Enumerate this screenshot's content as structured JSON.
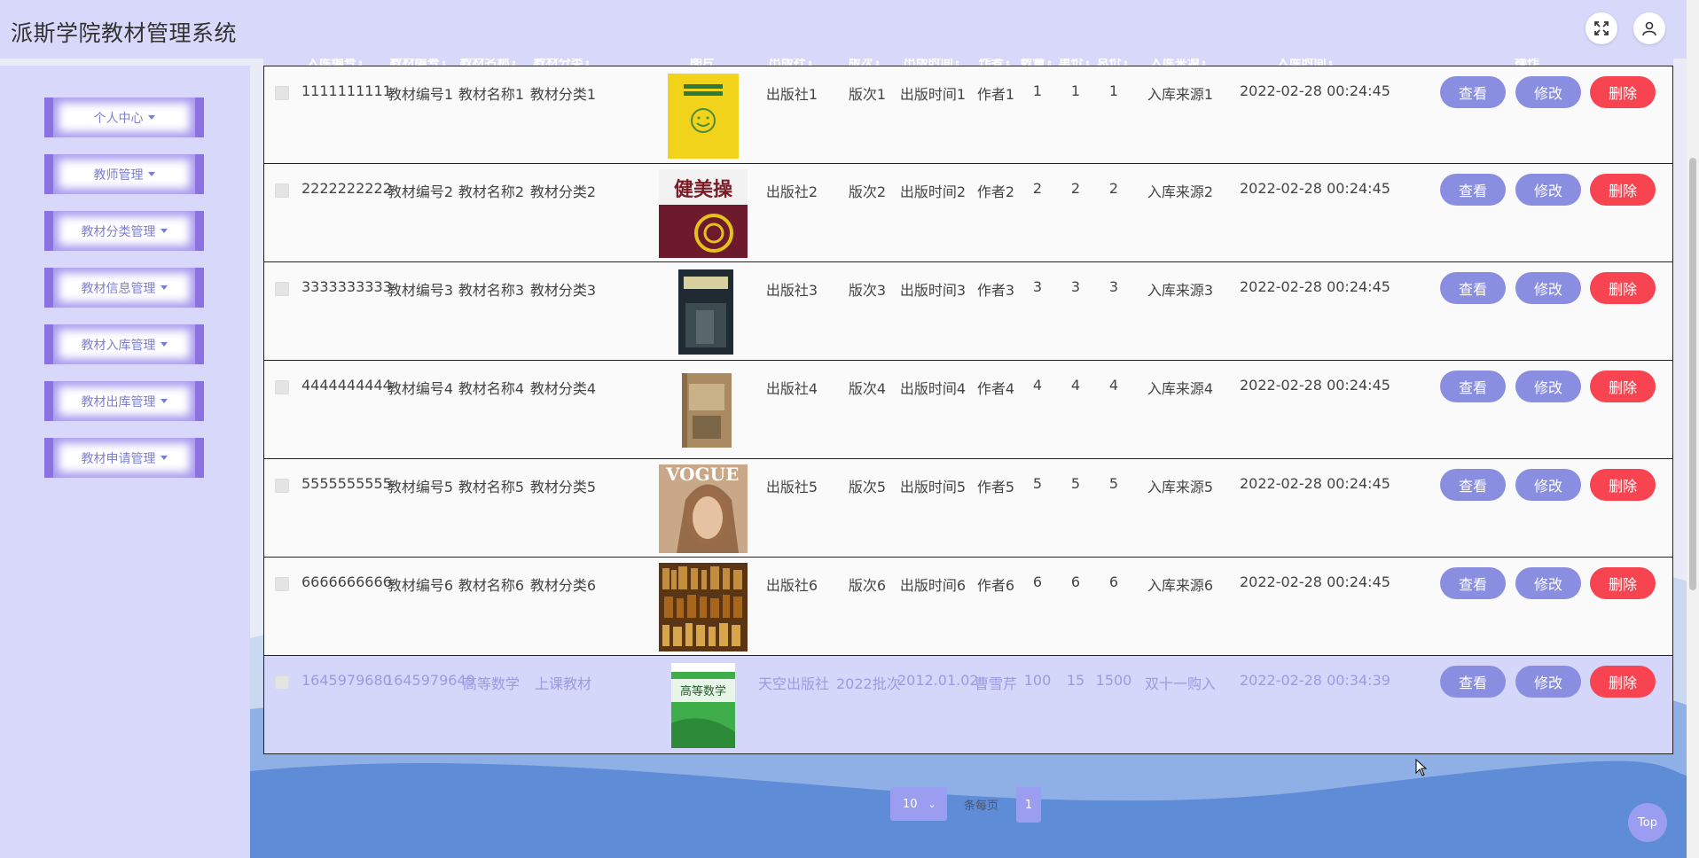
{
  "app": {
    "title": "派斯学院教材管理系统"
  },
  "top_buttons": {
    "fullscreen_icon": "fullscreen-icon",
    "user_icon": "user-icon"
  },
  "sidebar": {
    "items": [
      {
        "label": "个人中心"
      },
      {
        "label": "教师管理"
      },
      {
        "label": "教材分类管理"
      },
      {
        "label": "教材信息管理"
      },
      {
        "label": "教材入库管理"
      },
      {
        "label": "教材出库管理"
      },
      {
        "label": "教材申请管理"
      }
    ]
  },
  "table": {
    "headers": [
      "入库编号",
      "教材编号",
      "教材名称",
      "教材分类",
      "图片",
      "出版社",
      "版次",
      "出版时间",
      "作者",
      "数量",
      "单价",
      "总价",
      "入库来源",
      "入库时间",
      "操作"
    ],
    "buttons": {
      "view": "查看",
      "edit": "修改",
      "delete": "删除"
    },
    "rows": [
      {
        "id": "1111111111",
        "code": "教材编号1",
        "name": "教材名称1",
        "category": "教材分类1",
        "cover": "yellow-book-cover",
        "publisher": "出版社1",
        "edition": "版次1",
        "pub_time": "出版时间1",
        "author": "作者1",
        "qty": "1",
        "price": "1",
        "total": "1",
        "source": "入库来源1",
        "time": "2022-02-28 00:24:45"
      },
      {
        "id": "2222222222",
        "code": "教材编号2",
        "name": "教材名称2",
        "category": "教材分类2",
        "cover": "fitness-book-cover",
        "publisher": "出版社2",
        "edition": "版次2",
        "pub_time": "出版时间2",
        "author": "作者2",
        "qty": "2",
        "price": "2",
        "total": "2",
        "source": "入库来源2",
        "time": "2022-02-28 00:24:45"
      },
      {
        "id": "3333333333",
        "code": "教材编号3",
        "name": "教材名称3",
        "category": "教材分类3",
        "cover": "dark-book-cover",
        "publisher": "出版社3",
        "edition": "版次3",
        "pub_time": "出版时间3",
        "author": "作者3",
        "qty": "3",
        "price": "3",
        "total": "3",
        "source": "入库来源3",
        "time": "2022-02-28 00:24:45"
      },
      {
        "id": "4444444444",
        "code": "教材编号4",
        "name": "教材名称4",
        "category": "教材分类4",
        "cover": "classic-book-cover",
        "publisher": "出版社4",
        "edition": "版次4",
        "pub_time": "出版时间4",
        "author": "作者4",
        "qty": "4",
        "price": "4",
        "total": "4",
        "source": "入库来源4",
        "time": "2022-02-28 00:24:45"
      },
      {
        "id": "5555555555",
        "code": "教材编号5",
        "name": "教材名称5",
        "category": "教材分类5",
        "cover": "magazine-cover",
        "publisher": "出版社5",
        "edition": "版次5",
        "pub_time": "出版时间5",
        "author": "作者5",
        "qty": "5",
        "price": "5",
        "total": "5",
        "source": "入库来源5",
        "time": "2022-02-28 00:24:45"
      },
      {
        "id": "6666666666",
        "code": "教材编号6",
        "name": "教材名称6",
        "category": "教材分类6",
        "cover": "bookshelf-image",
        "publisher": "出版社6",
        "edition": "版次6",
        "pub_time": "出版时间6",
        "author": "作者6",
        "qty": "6",
        "price": "6",
        "total": "6",
        "source": "入库来源6",
        "time": "2022-02-28 00:24:45"
      },
      {
        "id": "1645979680",
        "code": "1645979649",
        "name": "高等数学",
        "category": "上课教材",
        "cover": "math-book-cover",
        "publisher": "天空出版社",
        "edition": "2022批次",
        "pub_time": "2012.01.02",
        "author": "曹雪芹",
        "qty": "100",
        "price": "15",
        "total": "1500",
        "source": "双十一购入",
        "time": "2022-02-28 00:34:39"
      }
    ]
  },
  "pager": {
    "page_size": "10",
    "per_page_label": "条每页",
    "current_page": "1"
  },
  "back_to_top": "Top",
  "colors": {
    "accent": "#8a8ee0",
    "danger": "#f74450",
    "header_bg": "#d8d9fa"
  }
}
